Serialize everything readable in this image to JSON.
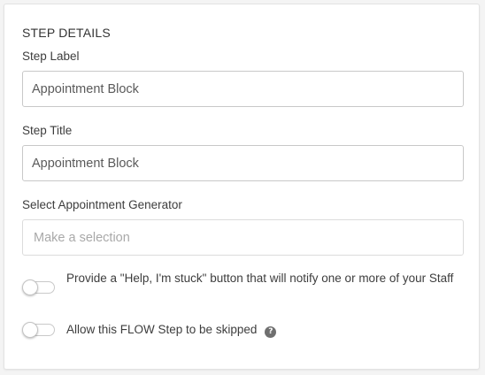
{
  "step_details": {
    "section_title": "STEP DETAILS",
    "step_label": {
      "label": "Step Label",
      "value": "Appointment Block"
    },
    "step_title": {
      "label": "Step Title",
      "value": "Appointment Block"
    },
    "appointment_generator": {
      "label": "Select Appointment Generator",
      "placeholder": "Make a selection"
    },
    "help_toggle": {
      "label": "Provide a \"Help, I'm stuck\" button that will notify one or more of your Staff",
      "enabled": false
    },
    "skip_toggle": {
      "label": "Allow this FLOW Step to be skipped",
      "enabled": false,
      "help_icon": "question-icon",
      "help_glyph": "?"
    }
  }
}
